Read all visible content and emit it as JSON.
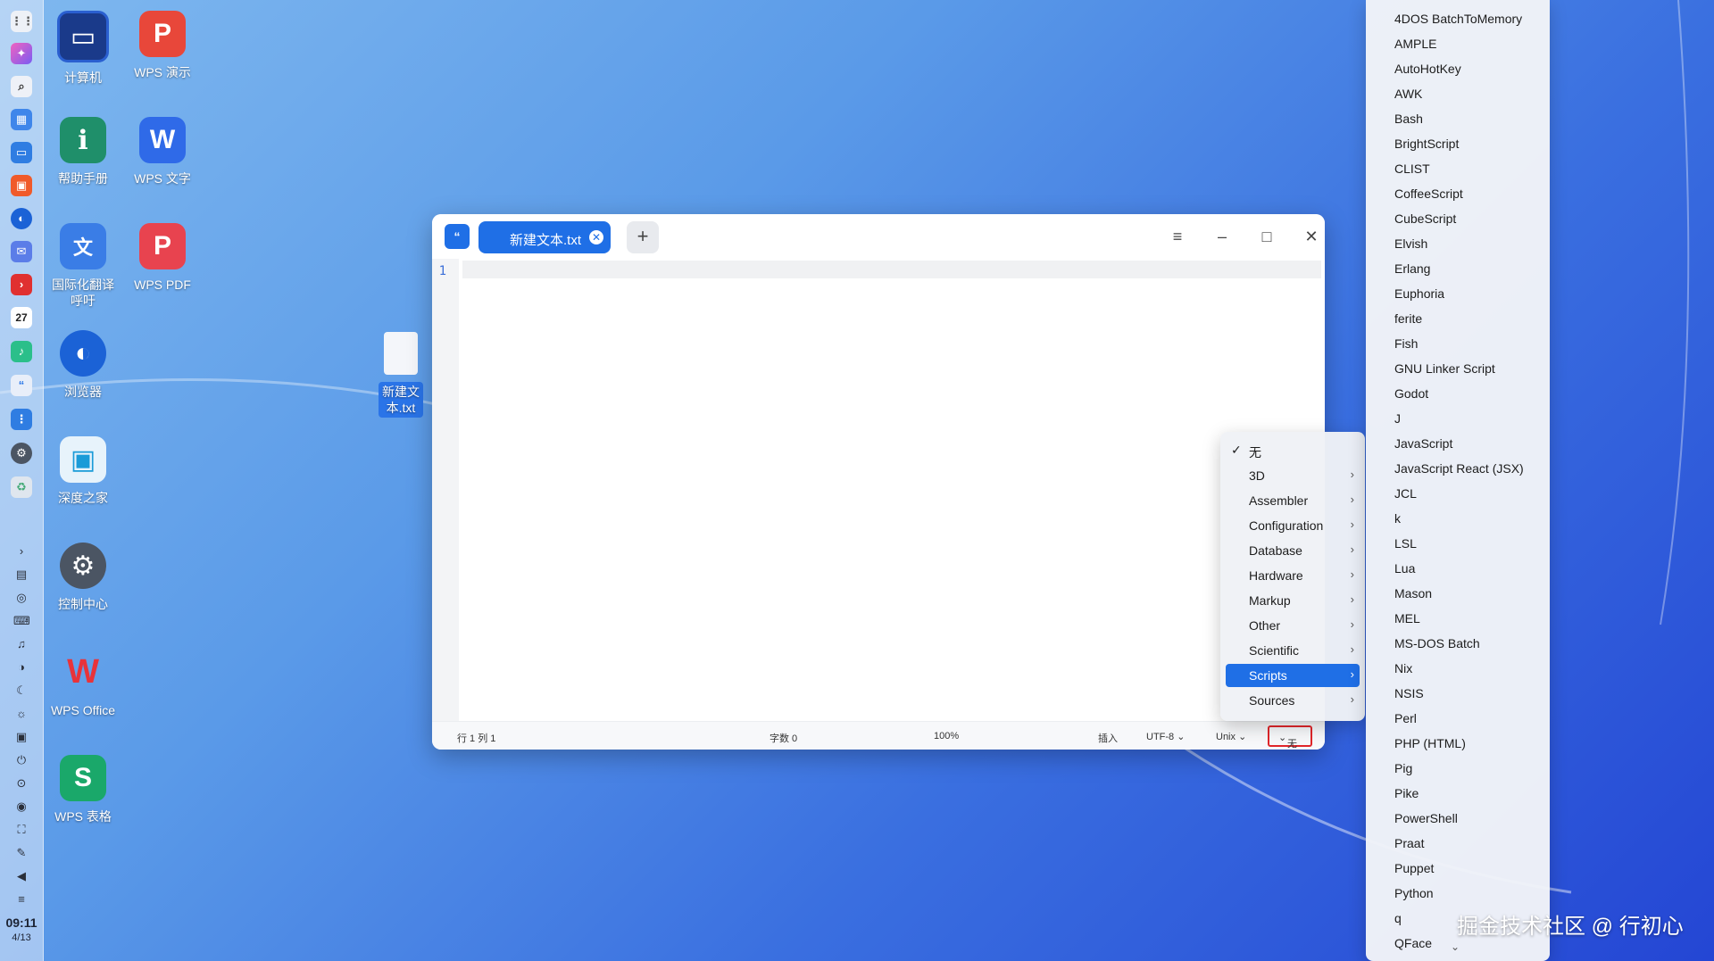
{
  "desktop": {
    "icons": [
      {
        "label": "计算机"
      },
      {
        "label": "WPS 演示"
      },
      {
        "label": "帮助手册"
      },
      {
        "label": "WPS 文字"
      },
      {
        "label": "国际化翻译\n呼吁"
      },
      {
        "label": "WPS PDF"
      },
      {
        "label": "浏览器"
      },
      {
        "label": "深度之家"
      },
      {
        "label": "控制中心"
      },
      {
        "label": "WPS Office"
      },
      {
        "label": "WPS 表格"
      }
    ],
    "file_icon": {
      "label": "新建文\n本.txt"
    }
  },
  "dock": {
    "calendar_day": "27",
    "time": "09:11",
    "date": "4/13"
  },
  "editor": {
    "tab_title": "新建文本.txt",
    "line_number": "1",
    "status": {
      "position": "行 1  列 1",
      "char_count": "字数 0",
      "zoom": "100%",
      "mode": "插入",
      "encoding": "UTF-8",
      "line_ending": "Unix",
      "highlight": "无"
    }
  },
  "highlight_menu": {
    "selected": "无",
    "items": [
      "3D",
      "Assembler",
      "Configuration",
      "Database",
      "Hardware",
      "Markup",
      "Other",
      "Scientific",
      "Scripts",
      "Sources"
    ],
    "active": "Scripts"
  },
  "scripts_submenu": {
    "items": [
      "4DOS BatchToMemory",
      "AMPLE",
      "AutoHotKey",
      "AWK",
      "Bash",
      "BrightScript",
      "CLIST",
      "CoffeeScript",
      "CubeScript",
      "Elvish",
      "Erlang",
      "Euphoria",
      "ferite",
      "Fish",
      "GNU Linker Script",
      "Godot",
      "J",
      "JavaScript",
      "JavaScript React (JSX)",
      "JCL",
      "k",
      "LSL",
      "Lua",
      "Mason",
      "MEL",
      "MS-DOS Batch",
      "Nix",
      "NSIS",
      "Perl",
      "PHP (HTML)",
      "Pig",
      "Pike",
      "PowerShell",
      "Praat",
      "Puppet",
      "Python",
      "q",
      "QFace"
    ]
  },
  "watermark": "掘金技术社区 @ 行初心",
  "colors": {
    "accent": "#1f6fe6",
    "highlight_box": "#e0262a"
  }
}
